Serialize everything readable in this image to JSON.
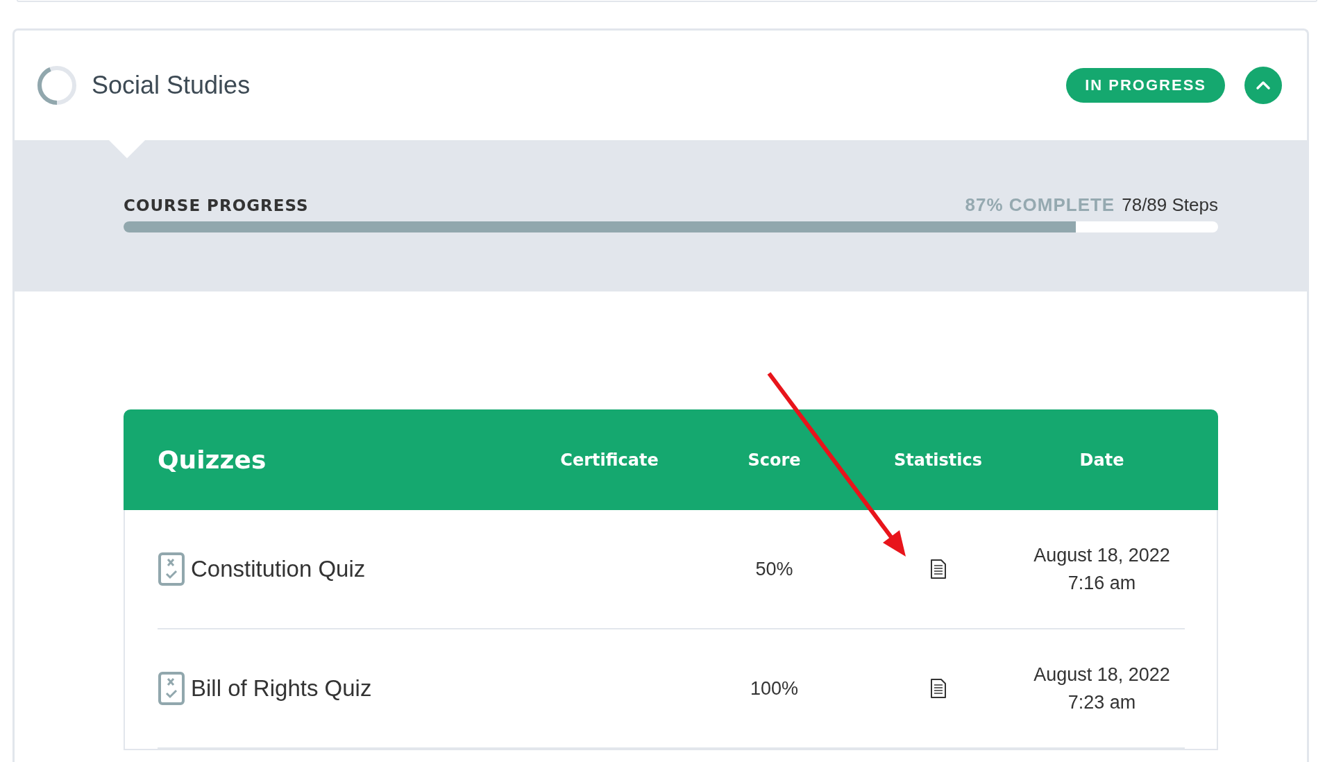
{
  "course": {
    "title": "Social Studies",
    "status": "IN PROGRESS",
    "expanded": true,
    "progress": {
      "label": "COURSE PROGRESS",
      "percent_text": "87% COMPLETE",
      "steps": "78/89 Steps",
      "level": 0.87
    }
  },
  "quizzes": {
    "columns": [
      "Quizzes",
      "Certificate",
      "Score",
      "Statistics",
      "Date"
    ],
    "rows": [
      {
        "name": "Constitution Quiz",
        "score": "50%",
        "date": "August 18, 2022",
        "time": "7:16 am"
      },
      {
        "name": "Bill of Rights Quiz",
        "score": "100%",
        "date": "August 18, 2022",
        "time": "7:23 am"
      }
    ]
  }
}
